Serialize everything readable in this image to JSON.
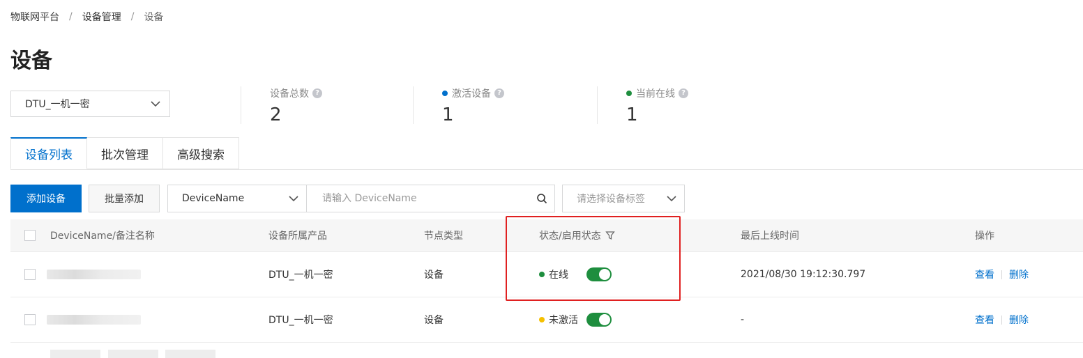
{
  "breadcrumb": {
    "items": [
      {
        "label": "物联网平台"
      },
      {
        "label": "设备管理"
      }
    ],
    "current": "设备",
    "separator": "/"
  },
  "page_title": "设备",
  "product_select": {
    "value": "DTU_一机一密"
  },
  "stats": [
    {
      "label": "设备总数",
      "value": "2",
      "help": "?"
    },
    {
      "label": "激活设备",
      "value": "1",
      "dot_color": "#0070cc",
      "help": "?"
    },
    {
      "label": "当前在线",
      "value": "1",
      "dot_color": "#1e8e3e",
      "help": "?"
    }
  ],
  "tabs": [
    {
      "label": "设备列表",
      "active": true
    },
    {
      "label": "批次管理",
      "active": false
    },
    {
      "label": "高级搜索",
      "active": false
    }
  ],
  "toolbar": {
    "add_label": "添加设备",
    "batch_add_label": "批量添加",
    "field_select": "DeviceName",
    "search_placeholder": "请输入 DeviceName",
    "tag_placeholder": "请选择设备标签"
  },
  "table": {
    "headers": {
      "name": "DeviceName/备注名称",
      "product": "设备所属产品",
      "node_type": "节点类型",
      "status": "状态/启用状态",
      "last_online": "最后上线时间",
      "actions": "操作"
    },
    "rows": [
      {
        "product": "DTU_一机一密",
        "node_type": "设备",
        "status": "在线",
        "status_color": "#1e8e3e",
        "enabled": true,
        "last_online": "2021/08/30 19:12:30.797",
        "view": "查看",
        "delete": "删除"
      },
      {
        "product": "DTU_一机一密",
        "node_type": "设备",
        "status": "未激活",
        "status_color": "#f5c000",
        "enabled": true,
        "last_online": "-",
        "view": "查看",
        "delete": "删除"
      }
    ]
  },
  "colors": {
    "primary": "#0070cc",
    "online": "#1e8e3e",
    "inactive": "#f5c000",
    "highlight": "#e02020"
  }
}
